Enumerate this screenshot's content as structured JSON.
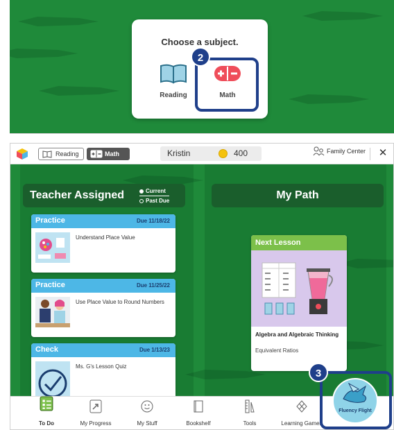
{
  "subject_chooser": {
    "title": "Choose a subject.",
    "reading_label": "Reading",
    "math_label": "Math",
    "step_badge": "2"
  },
  "topbar": {
    "reading_tab": "Reading",
    "math_tab": "Math",
    "user_name": "Kristin",
    "coins": "400",
    "family_center": "Family Center",
    "close": "✕"
  },
  "teacher_assigned": {
    "title": "Teacher Assigned",
    "filter_current": "Current",
    "filter_past_due": "Past Due",
    "tasks": [
      {
        "type": "Practice",
        "due": "Due 11/18/22",
        "text": "Understand Place Value"
      },
      {
        "type": "Practice",
        "due": "Due 11/25/22",
        "text": "Use Place Value to Round Numbers"
      },
      {
        "type": "Check",
        "due": "Due 1/13/23",
        "text": "Ms. G's Lesson Quiz"
      }
    ]
  },
  "my_path": {
    "title": "My Path",
    "next_lesson_label": "Next Lesson",
    "lesson_title": "Algebra and Algebraic Thinking",
    "lesson_subtitle": "Equivalent Ratios"
  },
  "bottom_nav": {
    "items": [
      {
        "label": "To Do"
      },
      {
        "label": "My Progress"
      },
      {
        "label": "My Stuff"
      },
      {
        "label": "Bookshelf"
      },
      {
        "label": "Tools"
      },
      {
        "label": "Learning Games"
      }
    ],
    "fluency_flight": "Fluency Flight",
    "step_badge": "3"
  },
  "colors": {
    "background_green": "#1f8a3a",
    "callout_blue": "#1f3f8a",
    "task_header_blue": "#4db7e6",
    "lesson_header_green": "#7cc04a"
  }
}
